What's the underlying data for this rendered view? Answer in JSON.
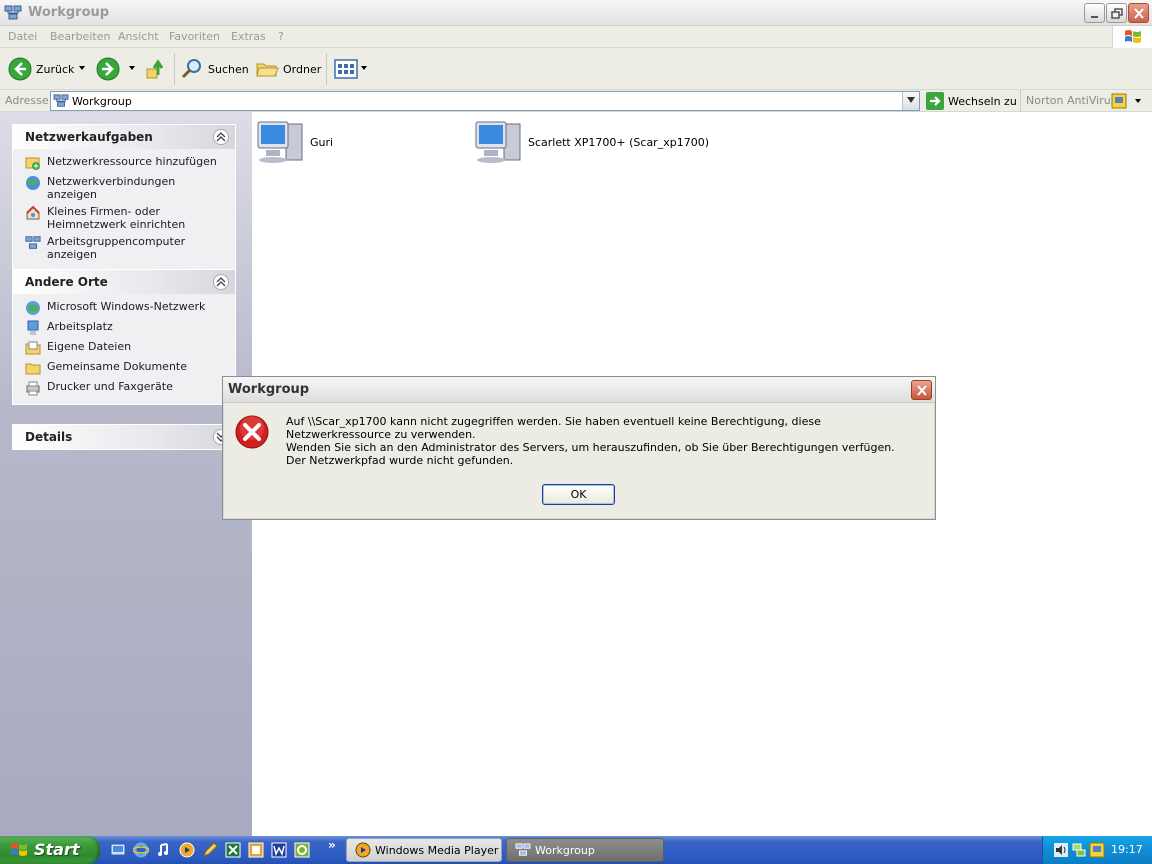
{
  "window": {
    "title": "Workgroup",
    "menu": [
      "Datei",
      "Bearbeiten",
      "Ansicht",
      "Favoriten",
      "Extras",
      "?"
    ]
  },
  "toolbar": {
    "back_label": "Zurück",
    "search_label": "Suchen",
    "folders_label": "Ordner"
  },
  "address": {
    "label": "Adresse",
    "value": "Workgroup",
    "go_label": "Wechseln zu",
    "norton_label": "Norton AntiVirus"
  },
  "sidebar": {
    "panels": [
      {
        "title": "Netzwerkaufgaben",
        "items": [
          {
            "label": "Netzwerkressource hinzufügen",
            "icon": "add-network-place-icon"
          },
          {
            "label": "Netzwerkverbindungen anzeigen",
            "icon": "network-connections-icon"
          },
          {
            "label": "Kleines Firmen- oder Heimnetzwerk einrichten",
            "icon": "home-network-icon"
          },
          {
            "label": "Arbeitsgruppencomputer anzeigen",
            "icon": "workgroup-computers-icon"
          }
        ]
      },
      {
        "title": "Andere Orte",
        "items": [
          {
            "label": "Microsoft Windows-Netzwerk",
            "icon": "windows-network-icon"
          },
          {
            "label": "Arbeitsplatz",
            "icon": "my-computer-icon"
          },
          {
            "label": "Eigene Dateien",
            "icon": "my-documents-icon"
          },
          {
            "label": "Gemeinsame Dokumente",
            "icon": "shared-documents-icon"
          },
          {
            "label": "Drucker und Faxgeräte",
            "icon": "printers-icon"
          }
        ]
      },
      {
        "title": "Details",
        "items": []
      }
    ]
  },
  "content": {
    "computers": [
      {
        "label": "Guri"
      },
      {
        "label": "Scarlett XP1700+ (Scar_xp1700)"
      }
    ]
  },
  "dialog": {
    "title": "Workgroup",
    "message_line1": "Auf \\\\Scar_xp1700 kann nicht zugegriffen werden. Sie haben eventuell keine Berechtigung, diese Netzwerkressource zu verwenden.",
    "message_line2": "Wenden Sie sich an den Administrator des Servers, um herauszufinden, ob Sie über Berechtigungen verfügen.",
    "message_detail": "Der Netzwerkpfad wurde nicht gefunden.",
    "ok_label": "OK"
  },
  "taskbar": {
    "start_label": "Start",
    "more_label": "»",
    "tasks": [
      {
        "label": "Windows Media Player"
      },
      {
        "label": "Workgroup"
      }
    ],
    "clock": "19:17"
  },
  "colors": {
    "sidebar_gradient_top": "#dcdde6",
    "sidebar_gradient_bottom": "#a7aac0",
    "taskbar_blue": "#2c5ac0",
    "start_green": "#3c9c3c",
    "tray_blue": "#1290d6",
    "error_red": "#d21e1e"
  }
}
